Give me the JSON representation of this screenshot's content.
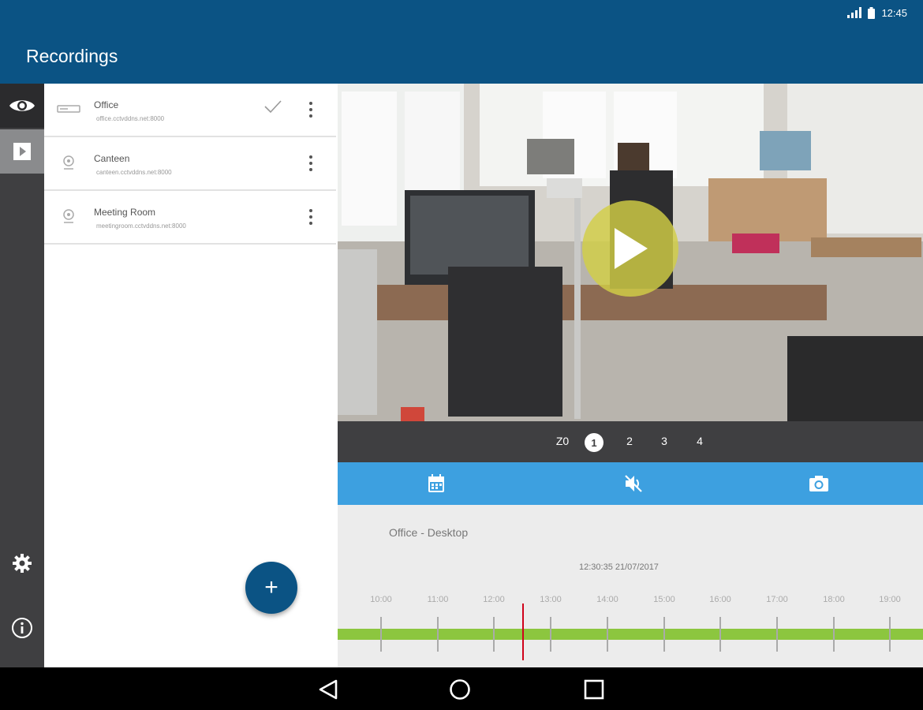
{
  "status": {
    "time": "12:45"
  },
  "header": {
    "title": "Recordings"
  },
  "rail": {
    "items": [
      {
        "icon": "eye-icon",
        "state": "active"
      },
      {
        "icon": "play-square-icon",
        "state": "selected"
      },
      {
        "icon": "gear-icon"
      },
      {
        "icon": "info-icon"
      }
    ]
  },
  "cameras": [
    {
      "name": "Office",
      "address": "office.cctvddns.net:8000",
      "icon": "dvr-icon",
      "selected": true
    },
    {
      "name": "Canteen",
      "address": "canteen.cctvddns.net:8000",
      "icon": "webcam-icon"
    },
    {
      "name": "Meeting Room",
      "address": "meetingroom.cctvddns.net:8000",
      "icon": "webcam-icon"
    }
  ],
  "fab": {
    "label": "+"
  },
  "pager": {
    "prefix": "Z0",
    "pages": [
      "1",
      "2",
      "3",
      "4"
    ],
    "active": "1"
  },
  "toolbar": {
    "buttons": [
      "calendar-icon",
      "mute-icon",
      "camera-icon"
    ]
  },
  "timeline": {
    "clip_title": "Office - Desktop",
    "timestamp": "12:30:35   21/07/2017",
    "hours": [
      "10:00",
      "11:00",
      "12:00",
      "13:00",
      "14:00",
      "15:00",
      "16:00",
      "17:00",
      "18:00",
      "19:00"
    ]
  },
  "colors": {
    "appbar": "#0b5384",
    "rail": "#3f3f41",
    "toolbar": "#3da0e0",
    "timeline_bar": "#8cc63f",
    "cursor": "#d0021b",
    "play": "#d2ce46"
  }
}
